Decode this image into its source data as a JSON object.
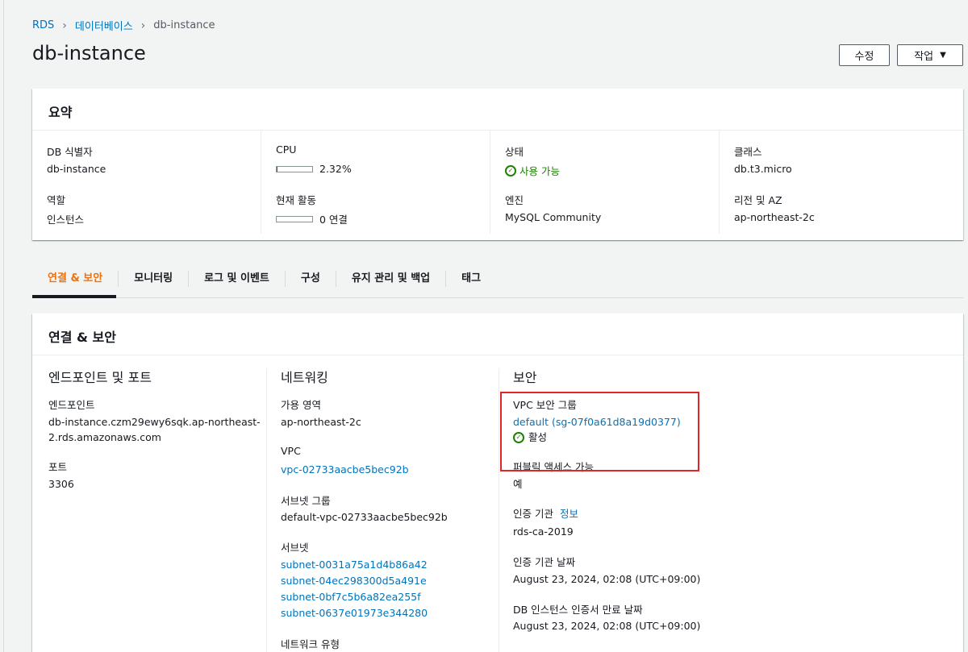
{
  "breadcrumb": {
    "root": "RDS",
    "databases": "데이터베이스",
    "current": "db-instance"
  },
  "title": "db-instance",
  "buttons": {
    "edit": "수정",
    "action": "작업"
  },
  "summary": {
    "header": "요약",
    "db_id_label": "DB 식별자",
    "db_id": "db-instance",
    "role_label": "역할",
    "role": "인스턴스",
    "cpu_label": "CPU",
    "cpu": "2.32%",
    "cpu_fraction": 0.0232,
    "activity_label": "현재 활동",
    "activity": "0 연결",
    "activity_fraction": 0,
    "status_label": "상태",
    "status": "사용 가능",
    "engine_label": "엔진",
    "engine": "MySQL Community",
    "class_label": "클래스",
    "class": "db.t3.micro",
    "region_label": "리전 및 AZ",
    "region": "ap-northeast-2c"
  },
  "tabs": [
    "연결 & 보안",
    "모니터링",
    "로그 및 이벤트",
    "구성",
    "유지 관리 및 백업",
    "태그"
  ],
  "conn": {
    "header": "연결 & 보안",
    "endpoint_section": "엔드포인트 및 포트",
    "endpoint_label": "엔드포인트",
    "endpoint_line1": "db-instance.czm29ewy6sqk.ap-northeast-",
    "endpoint_line2": "2.rds.amazonaws.com",
    "port_label": "포트",
    "port": "3306",
    "network_section": "네트워킹",
    "az_label": "가용 영역",
    "az": "ap-northeast-2c",
    "vpc_label": "VPC",
    "vpc": "vpc-02733aacbe5bec92b",
    "subnet_group_label": "서브넷 그룹",
    "subnet_group": "default-vpc-02733aacbe5bec92b",
    "subnets_label": "서브넷",
    "subnets": [
      "subnet-0031a75a1d4b86a42",
      "subnet-04ec298300d5a491e",
      "subnet-0bf7c5b6a82ea255f",
      "subnet-0637e01973e344280"
    ],
    "network_type_label": "네트워크 유형",
    "security_section": "보안",
    "sg_label": "VPC 보안 그룹",
    "sg": "default (sg-07f0a61d8a19d0377)",
    "sg_status": "활성",
    "public_label": "퍼블릭 액세스 가능",
    "public": "예",
    "ca_label": "인증 기관",
    "ca_info": "정보",
    "ca": "rds-ca-2019",
    "ca_date_label": "인증 기관 날짜",
    "ca_date": "August 23, 2024, 02:08 (UTC+09:00)",
    "cert_exp_label": "DB 인스턴스 인증서 만료 날짜",
    "cert_exp": "August 23, 2024, 02:08 (UTC+09:00)"
  }
}
